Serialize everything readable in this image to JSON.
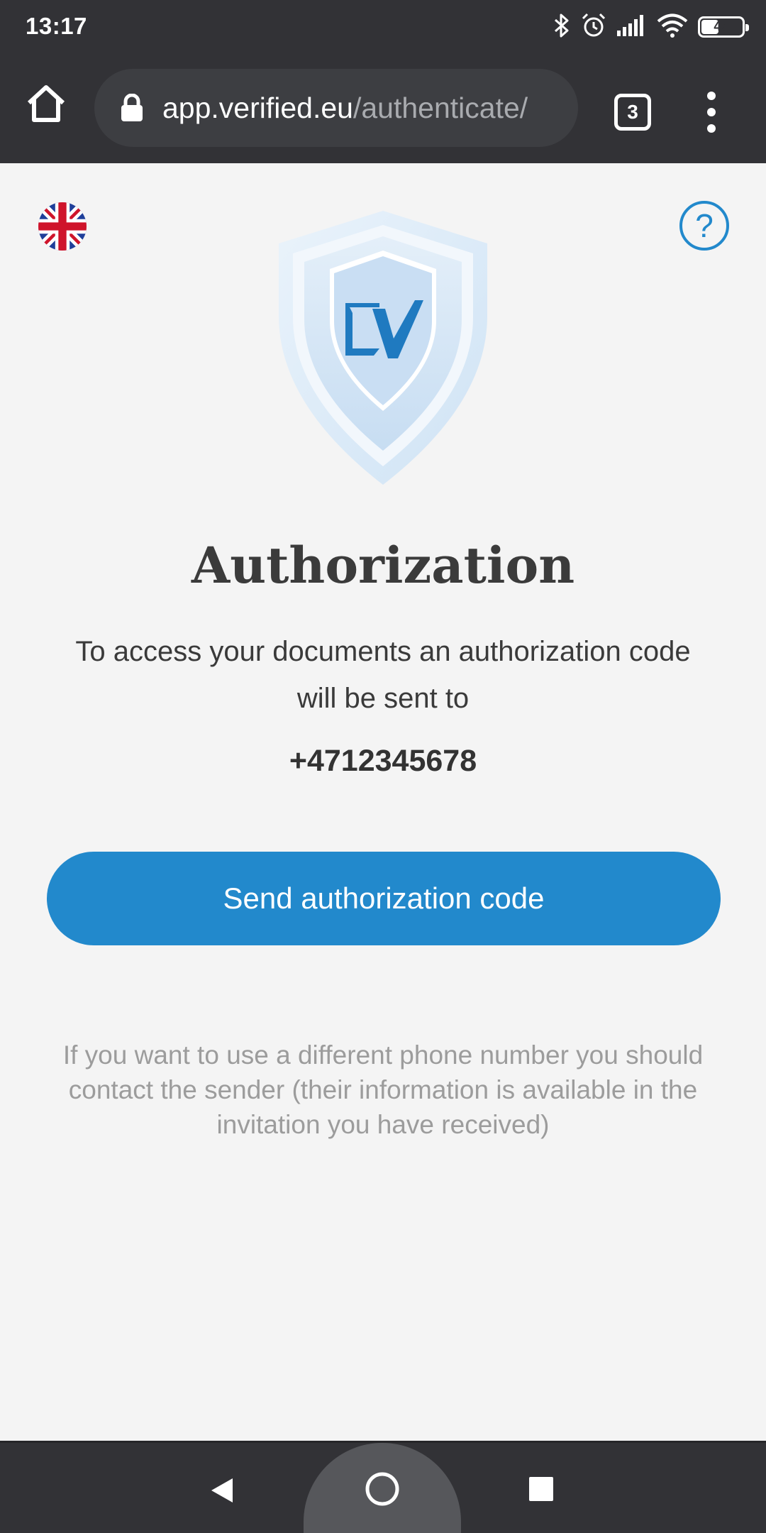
{
  "status_bar": {
    "time": "13:17",
    "battery": "46",
    "battery_level": 0.46,
    "icons": [
      "bluetooth-icon",
      "alarm-icon",
      "signal-icon",
      "wifi-icon",
      "battery-icon"
    ]
  },
  "browser": {
    "url_domain": "app.verified.eu",
    "url_path": "/authenticate/",
    "tab_count": "3",
    "icons": [
      "home-icon",
      "lock-icon",
      "tabs-icon",
      "more-vert-icon"
    ]
  },
  "page": {
    "language_flag": "uk-flag-icon",
    "help_icon": "question-mark-icon",
    "help_text": "?",
    "logo": "verified-shield-logo",
    "title": "Authorization",
    "description": "To access your documents an authorization code will be sent to",
    "phone": "+4712345678",
    "send_button": "Send authorization code",
    "note": "If you want to use a different phone number you should contact the sender (their information is available in the invitation you have received)"
  },
  "colors": {
    "accent": "#2289cc",
    "system_bar": "#323236",
    "background": "#f4f4f4"
  },
  "nav_bar": {
    "icons": [
      "back-icon",
      "home-circle-icon",
      "recents-icon"
    ]
  }
}
